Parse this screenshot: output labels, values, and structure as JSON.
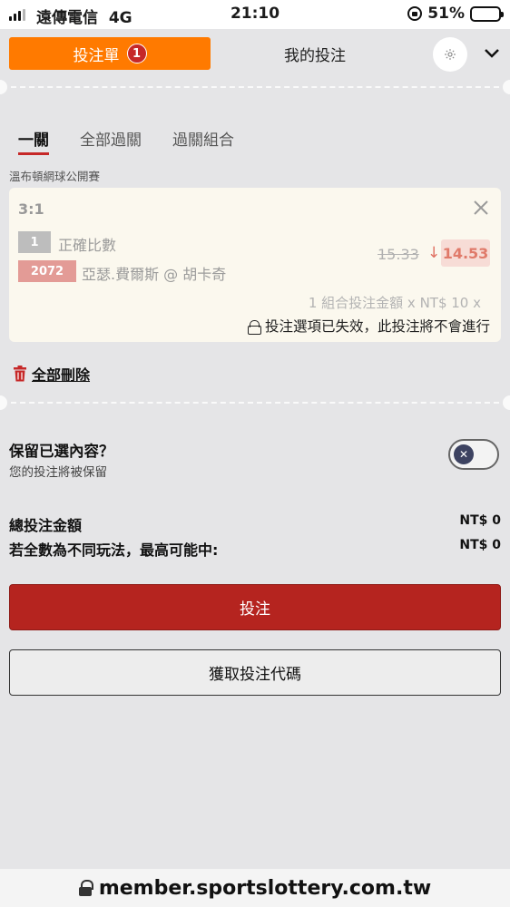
{
  "status_bar": {
    "carrier": "遠傳電信",
    "network": "4G",
    "time": "21:10",
    "battery": "51%",
    "battery_level": 0.51
  },
  "header": {
    "betslip_label": "投注單",
    "betslip_count": "1",
    "mybets_label": "我的投注",
    "accent_color": "#ff7a00"
  },
  "bet_tabs": [
    "一關",
    "全部過關",
    "過關組合"
  ],
  "tournament": "溫布頓網球公開賽",
  "selection": {
    "score": "3:1",
    "market_code": "1",
    "market_name": "正確比數",
    "event_code": "2072",
    "event_name": "亞瑟.費爾斯 @ 胡卡奇",
    "old_odds": "15.33",
    "new_odds": "14.53",
    "combo_text": "1 組合投注金額 x NT$ 10 x",
    "invalid_text": "投注選項已失效，此投注將不會進行"
  },
  "delete_all_label": "全部刪除",
  "keep": {
    "title": "保留已選內容？",
    "subtitle": "您的投注將被保留"
  },
  "totals": {
    "total_label": "總投注金額",
    "total_value": "NT$ 0",
    "max_label": "若全數為不同玩法，最高可能中:",
    "max_value": "NT$ 0"
  },
  "buttons": {
    "bet": "投注",
    "get_code": "獲取投注代碼"
  },
  "url": "member.sportslottery.com.tw",
  "icons": {
    "settings": "gear-icon",
    "expand": "chevron-down-icon",
    "close": "close-icon",
    "trash": "trash-icon",
    "lock": "lock-icon"
  }
}
